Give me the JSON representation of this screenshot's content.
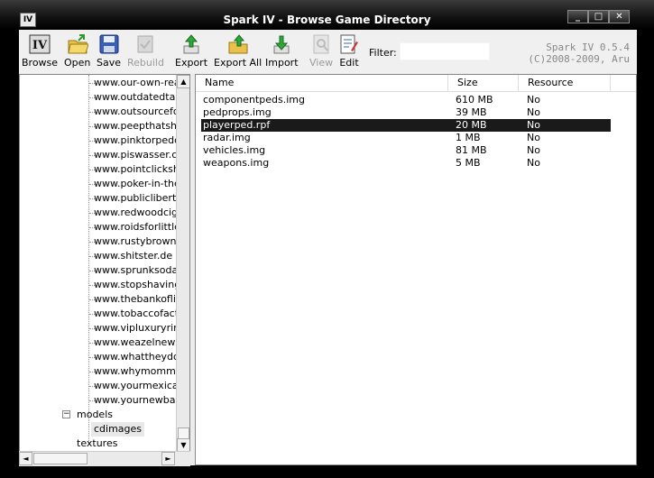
{
  "window": {
    "title": "Spark IV - Browse Game Directory",
    "app_icon_text": "IV",
    "minimize_glyph": "_",
    "maximize_glyph": "□",
    "close_glyph": "✕"
  },
  "toolbar": {
    "buttons": [
      {
        "label": "Browse",
        "icon": "iv-logo-icon",
        "enabled": true
      },
      {
        "label": "Open",
        "icon": "folder-open-icon",
        "enabled": true
      },
      {
        "label": "Save",
        "icon": "floppy-disk-icon",
        "enabled": true
      },
      {
        "label": "Rebuild",
        "icon": "rebuild-icon",
        "enabled": false
      },
      {
        "label": "Export",
        "icon": "export-icon",
        "enabled": true
      },
      {
        "label": "Export All",
        "icon": "export-all-icon",
        "enabled": true
      },
      {
        "label": "Import",
        "icon": "import-icon",
        "enabled": true
      },
      {
        "label": "View",
        "icon": "view-icon",
        "enabled": false
      },
      {
        "label": "Edit",
        "icon": "edit-icon",
        "enabled": true
      }
    ],
    "filter_label": "Filter:",
    "filter_value": "",
    "version_line1": "Spark IV 0.5.4",
    "version_line2": "(C)2008-2009, Aru"
  },
  "tree": {
    "items": [
      "www.our-own-reality",
      "www.outdatedtaste",
      "www.outsourcefora",
      "www.peepthatshit.c",
      "www.pinktorpedo.co",
      "www.piswasser.cor",
      "www.pointclickship",
      "www.poker-in-the-re",
      "www.publiclibertyor",
      "www.redwoodcigar",
      "www.roidsforlittlebo",
      "www.rustybrownsrir",
      "www.shitster.de",
      "www.sprunksoda.cc",
      "www.stopshavingnc",
      "www.thebankoflibe",
      "www.tobaccofacts.",
      "www.vipluxuryringtc",
      "www.weazelnews.c",
      "www.whattheydonc",
      "www.whymommygc",
      "www.yourmexicand",
      "www.yournewbaby-"
    ],
    "models_label": "models",
    "models_expander": "−",
    "cdimages_label": "cdimages",
    "textures_label": "textures",
    "scroll_up": "▲",
    "scroll_down": "▼",
    "scroll_left": "◄",
    "scroll_right": "►"
  },
  "list": {
    "columns": [
      "Name",
      "Size",
      "Resource"
    ],
    "rows": [
      {
        "name": "componentpeds.img",
        "size": "610 MB",
        "resource": "No",
        "selected": false
      },
      {
        "name": "pedprops.img",
        "size": "39 MB",
        "resource": "No",
        "selected": false
      },
      {
        "name": "playerped.rpf",
        "size": "20 MB",
        "resource": "No",
        "selected": true
      },
      {
        "name": "radar.img",
        "size": "1 MB",
        "resource": "No",
        "selected": false
      },
      {
        "name": "vehicles.img",
        "size": "81 MB",
        "resource": "No",
        "selected": false
      },
      {
        "name": "weapons.img",
        "size": "5 MB",
        "resource": "No",
        "selected": false
      }
    ]
  }
}
